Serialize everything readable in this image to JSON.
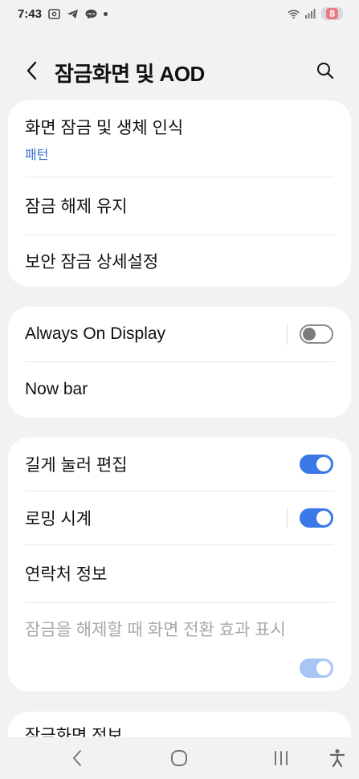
{
  "status_bar": {
    "time": "7:43",
    "battery": "8",
    "icons": [
      "screenshot-icon",
      "telegram-icon",
      "kakaotalk-icon",
      "dot-icon",
      "wifi-icon",
      "signal-icon"
    ]
  },
  "header": {
    "title": "잠금화면 및 AOD",
    "back_icon": "chevron-left-icon",
    "search_icon": "search-icon"
  },
  "card1": {
    "items": [
      {
        "title": "화면 잠금 및 생체 인식",
        "subtitle": "패턴"
      },
      {
        "title": "잠금 해제 유지"
      },
      {
        "title": "보안 잠금 상세설정"
      }
    ]
  },
  "card2": {
    "items": [
      {
        "title": "Always On Display",
        "toggle": "off"
      },
      {
        "title": "Now bar"
      }
    ]
  },
  "card3": {
    "items": [
      {
        "title": "길게 눌러 편집",
        "toggle": "on"
      },
      {
        "title": "로밍 시계",
        "toggle": "on"
      },
      {
        "title": "연락처 정보"
      },
      {
        "title": "잠금을 해제할 때 화면 전환 효과 표시",
        "toggle": "on",
        "disabled": true
      }
    ]
  },
  "card4": {
    "items": [
      {
        "title": "잠금화면 정보"
      }
    ]
  },
  "colors": {
    "accent": "#3b78e7",
    "subtitle": "#3b6fd6",
    "background": "#f2f2f4",
    "card": "#ffffff"
  },
  "nav_bar": {
    "icons": [
      "back-nav-icon",
      "home-nav-icon",
      "recents-nav-icon",
      "accessibility-icon"
    ]
  }
}
